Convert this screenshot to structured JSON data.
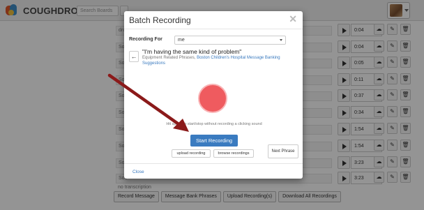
{
  "app": {
    "logo_text": "COUGHDROP",
    "search_placeholder": "Search Boards"
  },
  "background": {
    "row_texts": [
      "dru",
      "Sou",
      "Sou",
      "Sou",
      "Sou",
      "Sou",
      "Sou",
      "Sou",
      "Sou",
      "Sou",
      "no transcription"
    ],
    "durations": [
      "0:04",
      "0:04",
      "0:05",
      "0:11",
      "0:37",
      "0:34",
      "1:54",
      "1:54",
      "3:23",
      "3:23"
    ],
    "bottom_buttons": [
      "Record Message",
      "Message Bank Phrases",
      "Upload Recording(s)",
      "Download All Recordings"
    ]
  },
  "modal": {
    "title": "Batch Recording",
    "close_symbol": "✕",
    "recording_for_label": "Recording For",
    "recording_for_value": "me",
    "phrase": "\"I'm having the same kind of problem\"",
    "phrase_category": "Equipment Related Phrases,",
    "phrase_source": "Boston Children's Hospital Message Banking Suggestions",
    "hint": "Hit space to start/stop without recording a clicking sound",
    "start_button": "Start Recording",
    "upload_button": "upload recording",
    "browse_button": "browse recordings",
    "next_button": "Next Phrase",
    "close_link": "Close"
  },
  "colors": {
    "record_circle": "#ef5b5f",
    "primary_button": "#3a7bc0",
    "arrow": "#8b1a1a"
  },
  "icons": {
    "back": "arrow-left-icon",
    "play": "play-icon",
    "actions": [
      "cloud-download-icon",
      "pencil-icon",
      "trash-icon"
    ]
  }
}
